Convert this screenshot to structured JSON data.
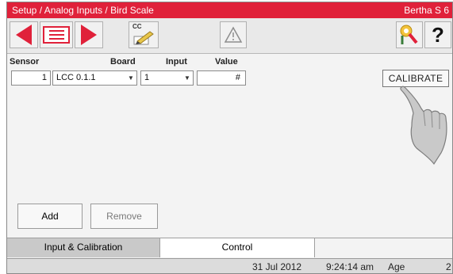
{
  "header": {
    "title": "Setup / Analog Inputs / Bird Scale",
    "device": "Bertha S 6"
  },
  "toolbar": {
    "back_icon": "left-arrow-icon",
    "list_icon": "menu-list-icon",
    "forward_icon": "right-arrow-icon",
    "copy_label": "CC",
    "warning_icon": "warning-icon",
    "settings_icon": "install-key-icon",
    "help_label": "?"
  },
  "grid": {
    "columns": [
      "Sensor",
      "Board",
      "Input",
      "Value"
    ],
    "rows": [
      {
        "sensor": "1",
        "board": "LCC 0.1.1",
        "input": "1",
        "value": "#"
      }
    ],
    "calibrate_label": "CALIBRATE"
  },
  "actions": {
    "add_label": "Add",
    "remove_label": "Remove"
  },
  "tabs": [
    {
      "label": "Input & Calibration",
      "active": true
    },
    {
      "label": "Control",
      "active": false
    }
  ],
  "status": {
    "date": "31 Jul 2012",
    "time": "9:24:14 am",
    "age_label": "Age",
    "age_value": "2"
  },
  "colors": {
    "title_bar": "#e0213a",
    "arrow": "#e0213a"
  }
}
